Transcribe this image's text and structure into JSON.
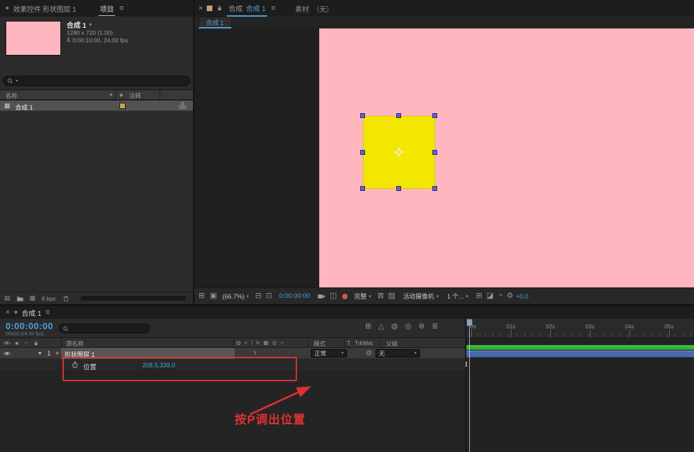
{
  "colors": {
    "accent_blue": "#4f9fd8",
    "comp_pink": "#ffb6bf",
    "shape_yellow": "#f3e600",
    "selection_handle_blue": "#5b67d8",
    "annotation_red": "#dc3232",
    "render_bar_green": "#36ad3b",
    "layer_bar_blue": "#4a69aa",
    "label_gold": "#c9a052"
  },
  "icons": {
    "panel": "■",
    "menu": "≡",
    "close": "×",
    "caret": "▾",
    "sort_caret": "▾",
    "expand": "▼",
    "label_diamond": "◆",
    "duration": "Δ",
    "comp_item": "▦",
    "pickwhip": "@",
    "shape_star": "★",
    "interpret": "▤",
    "new_comp": "▦",
    "always_preview": "⊞",
    "main_view": "▣",
    "grid_guides": "⊟",
    "mask_toggle": "⊡",
    "show_snapshot": "◫",
    "roi": "⊠",
    "transparency_grid": "▨",
    "share_view": "⊞",
    "pixel_aspect": "◪",
    "fast_preview": "◔",
    "gear": "⚙",
    "mini_flowchart": "⊞",
    "draft_3d": "△",
    "hide_shy": "◍",
    "frame_blend": "◎",
    "motion_blur": "⊛",
    "graph_editor": "≣",
    "solo": "○",
    "sw_shy": "◍",
    "sw_collapse": "+",
    "sw_quality": "\\",
    "sw_fx": "fx",
    "sw_blend": "▦",
    "sw_mblur": "◎",
    "sw_3d": "○"
  },
  "left_panel": {
    "tab_effect_controls": "效果控件 形状图层 1",
    "tab_project": "项目",
    "comp_name": "合成 1",
    "comp_size": "1280 x 720 (1.00)",
    "comp_duration": "0:00:10:00, 24.00 fps",
    "col_name": "名称",
    "col_comment": "注释",
    "row_name": "合成 1",
    "bpc": "8 bpc"
  },
  "viewer": {
    "tab_panel_label": "合成",
    "tab_comp_name": "合成 1",
    "tab_footage": "素材",
    "tab_footage_none": "（无）",
    "subtab": "合成 1",
    "zoom": "(66.7%)",
    "timecode": "0:00:00:00",
    "resolution": "完整",
    "camera": "活动摄像机",
    "layout": "1 个...",
    "exposure": "+0.0"
  },
  "timeline": {
    "tab": "合成 1",
    "timecode": "0:00:00:00",
    "frame_info": "00000 (24.00 fps)",
    "col_source": "源名称",
    "col_mode": "模式",
    "col_t": "T",
    "col_trkmat": "TrkMat",
    "col_parent": "父级",
    "layer_index": "1",
    "layer_name": "形状图层 1",
    "mode": "正常",
    "parent": "无",
    "prop_name": "位置",
    "prop_value": "208.5,339.0",
    "ruler": [
      "0s",
      "01s",
      "02s",
      "03s",
      "04s",
      "05s"
    ],
    "annotation": "按P调出位置"
  }
}
